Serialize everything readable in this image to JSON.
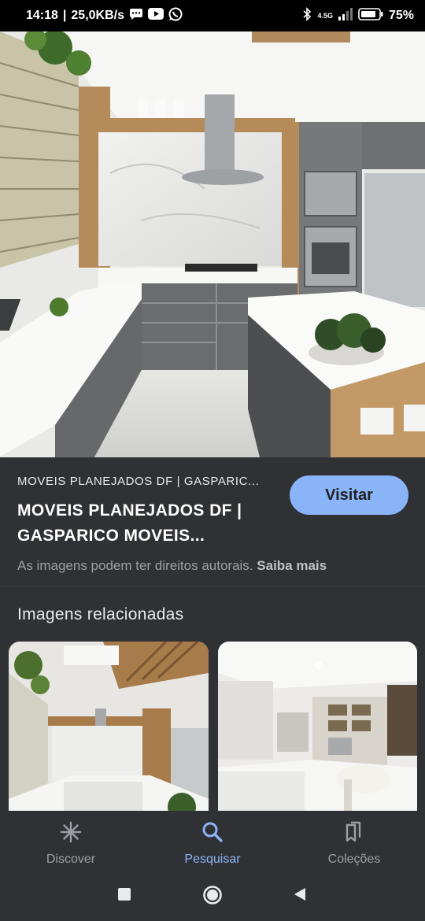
{
  "status_bar": {
    "time": "14:18",
    "speed": "25,0KB/s",
    "network": "4.5G",
    "battery": "75%",
    "icons": [
      "message-icon",
      "youtube-icon",
      "whatsapp-icon",
      "bluetooth-icon",
      "signal-icon",
      "battery-icon"
    ]
  },
  "result": {
    "source": "MOVEIS PLANEJADOS DF | GASPARIC...",
    "title_line1": "MOVEIS PLANEJADOS DF |",
    "title_line2": "GASPARICO MOVEIS...",
    "visit_label": "Visitar",
    "copyright_text": "As imagens podem ter direitos autorais.",
    "learn_more": "Saiba mais"
  },
  "related": {
    "heading": "Imagens relacionadas"
  },
  "bottom_nav": {
    "items": [
      {
        "label": "Discover",
        "icon": "asterisk-icon"
      },
      {
        "label": "Pesquisar",
        "icon": "search-icon",
        "active": true
      },
      {
        "label": "Coleções",
        "icon": "collections-icon"
      }
    ]
  },
  "system_nav": [
    "recents-icon",
    "home-icon",
    "back-icon"
  ],
  "colors": {
    "accent": "#8ab4f8",
    "background": "#202124",
    "surface": "#303134"
  }
}
